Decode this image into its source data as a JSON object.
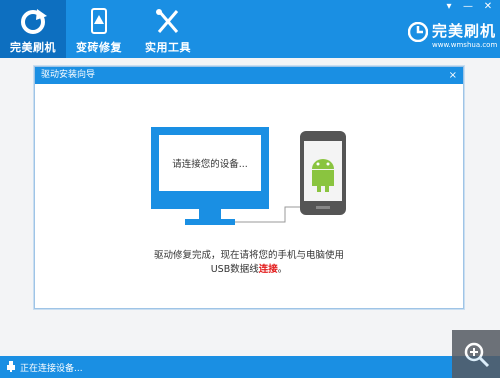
{
  "tabs": [
    {
      "label": "完美刷机"
    },
    {
      "label": "变砖修复"
    },
    {
      "label": "实用工具"
    }
  ],
  "window_controls": {
    "menu": "▾",
    "minimize": "—",
    "close": "✕"
  },
  "brand": {
    "name": "完美刷机",
    "url": "www.wmshua.com"
  },
  "dialog": {
    "title": "驱动安装向导",
    "close": "×",
    "monitor_text": "请连接您的设备...",
    "message_line1": "驱动修复完成，现在请将您的手机与电脑使用",
    "message_line2_prefix": "USB数据线",
    "message_line2_link": "连接",
    "message_line2_suffix": "。"
  },
  "status": {
    "text": "正在连接设备..."
  },
  "zoom_button": {
    "icon": "zoom-in-icon"
  },
  "colors": {
    "brand_blue": "#1a8fe3",
    "active_tab": "#0d6fc0",
    "link_red": "#e21b1b",
    "android_green": "#8ac43f"
  }
}
